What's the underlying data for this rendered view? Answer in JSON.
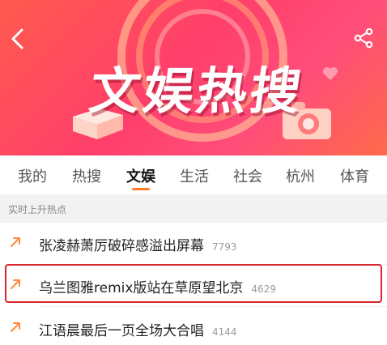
{
  "header": {
    "title": "文娱热搜",
    "colors": {
      "brand": "#ff4b6a",
      "accent": "#ff7a29"
    },
    "icons": {
      "back": "chevron-left-icon",
      "share": "share-icon"
    }
  },
  "tabs": [
    {
      "label": "我的"
    },
    {
      "label": "热搜"
    },
    {
      "label": "文娱",
      "active": true
    },
    {
      "label": "生活"
    },
    {
      "label": "社会"
    },
    {
      "label": "杭州"
    },
    {
      "label": "体育"
    }
  ],
  "section": {
    "label": "实时上升热点"
  },
  "list": [
    {
      "text": "张凌赫萧厉破碎感溢出屏幕",
      "count": "7793"
    },
    {
      "text": "乌兰图雅remix版站在草原望北京",
      "count": "4629"
    },
    {
      "text": "江语晨最后一页全场大合唱",
      "count": "4144"
    }
  ]
}
